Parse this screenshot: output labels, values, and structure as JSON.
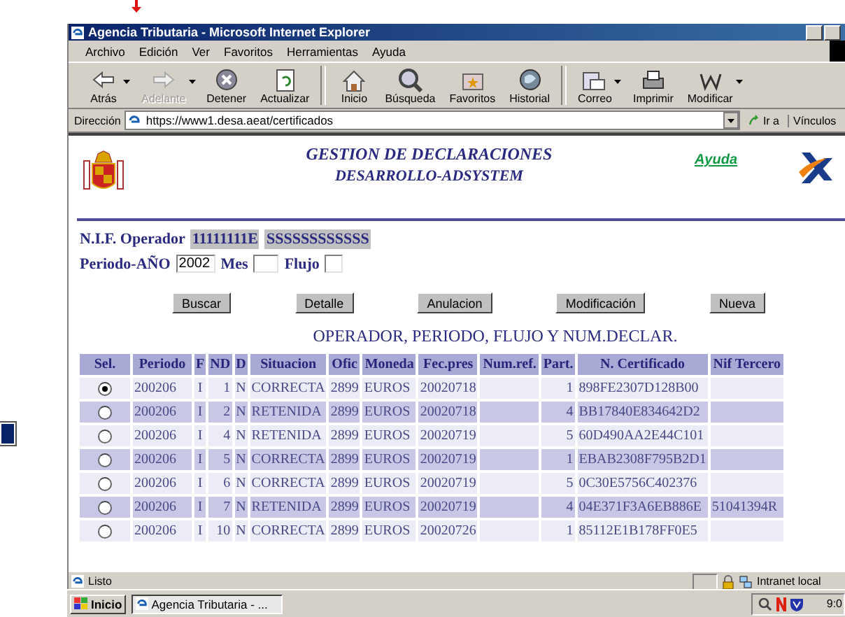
{
  "window": {
    "title": "Agencia Tributaria - Microsoft Internet Explorer"
  },
  "menu": [
    "Archivo",
    "Edición",
    "Ver",
    "Favoritos",
    "Herramientas",
    "Ayuda"
  ],
  "toolbar": [
    {
      "kind": "back",
      "label": "Atrás",
      "disabled": false,
      "dropdown": true
    },
    {
      "kind": "forward",
      "label": "Adelante",
      "disabled": true,
      "dropdown": true
    },
    {
      "kind": "stop",
      "label": "Detener",
      "disabled": false,
      "dropdown": false
    },
    {
      "kind": "refresh",
      "label": "Actualizar",
      "disabled": false,
      "dropdown": false
    },
    {
      "kind": "home",
      "label": "Inicio",
      "disabled": false,
      "dropdown": false
    },
    {
      "kind": "search",
      "label": "Búsqueda",
      "disabled": false,
      "dropdown": false
    },
    {
      "kind": "favorites",
      "label": "Favoritos",
      "disabled": false,
      "dropdown": false
    },
    {
      "kind": "history",
      "label": "Historial",
      "disabled": false,
      "dropdown": false
    },
    {
      "kind": "mail",
      "label": "Correo",
      "disabled": false,
      "dropdown": true
    },
    {
      "kind": "print",
      "label": "Imprimir",
      "disabled": false,
      "dropdown": false
    },
    {
      "kind": "edit",
      "label": "Modificar",
      "disabled": false,
      "dropdown": true
    }
  ],
  "address_bar": {
    "label": "Dirección",
    "value": "https://www1.desa.aeat/certificados",
    "go": "Ir a",
    "links": "Vínculos"
  },
  "page": {
    "title": "GESTION DE DECLARACIONES",
    "subtitle": "DESARROLLO-ADSYSTEM",
    "help_link": "Ayuda",
    "operator": {
      "label": "N.I.F. Operador",
      "nif": "11111111E",
      "name": "SSSSSSSSSSSS"
    },
    "period": {
      "label": "Periodo-AÑO",
      "year": "2002",
      "month_label": "Mes",
      "flow_label": "Flujo"
    },
    "buttons": [
      "Buscar",
      "Detalle",
      "Anulacion",
      "Modificación",
      "Nueva"
    ],
    "table": {
      "title": "OPERADOR, PERIODO, FLUJO Y NUM.DECLAR.",
      "columns": [
        "Sel.",
        "Periodo",
        "F",
        "ND",
        "D",
        "Situacion",
        "Ofic",
        "Moneda",
        "Fec.pres",
        "Num.ref.",
        "Part.",
        "N. Certificado",
        "Nif Tercero"
      ],
      "rows": [
        {
          "selected": true,
          "cells": [
            "",
            "200206",
            "I",
            "1",
            "N",
            "CORRECTA",
            "2899",
            "EUROS",
            "20020718",
            "",
            "1",
            "898FE2307D128B00",
            ""
          ]
        },
        {
          "selected": false,
          "cells": [
            "",
            "200206",
            "I",
            "2",
            "N",
            "RETENIDA",
            "2899",
            "EUROS",
            "20020718",
            "",
            "4",
            "BB17840E834642D2",
            ""
          ]
        },
        {
          "selected": false,
          "cells": [
            "",
            "200206",
            "I",
            "4",
            "N",
            "RETENIDA",
            "2899",
            "EUROS",
            "20020719",
            "",
            "5",
            "60D490AA2E44C101",
            ""
          ]
        },
        {
          "selected": false,
          "cells": [
            "",
            "200206",
            "I",
            "5",
            "N",
            "CORRECTA",
            "2899",
            "EUROS",
            "20020719",
            "",
            "1",
            "EBAB2308F795B2D1",
            ""
          ]
        },
        {
          "selected": false,
          "cells": [
            "",
            "200206",
            "I",
            "6",
            "N",
            "CORRECTA",
            "2899",
            "EUROS",
            "20020719",
            "",
            "5",
            "0C30E5756C402376",
            ""
          ]
        },
        {
          "selected": false,
          "cells": [
            "",
            "200206",
            "I",
            "7",
            "N",
            "RETENIDA",
            "2899",
            "EUROS",
            "20020719",
            "",
            "4",
            "04E371F3A6EB886E",
            "51041394R"
          ]
        },
        {
          "selected": false,
          "cells": [
            "",
            "200206",
            "I",
            "10",
            "N",
            "CORRECTA",
            "2899",
            "EUROS",
            "20020726",
            "",
            "1",
            "85112E1B178FF0E5",
            ""
          ]
        }
      ]
    }
  },
  "status_bar": {
    "text": "Listo",
    "zone": "Intranet local"
  },
  "taskbar": {
    "start": "Inicio",
    "tasks": [
      "Agencia Tributaria - ..."
    ],
    "clock": "9:0"
  }
}
